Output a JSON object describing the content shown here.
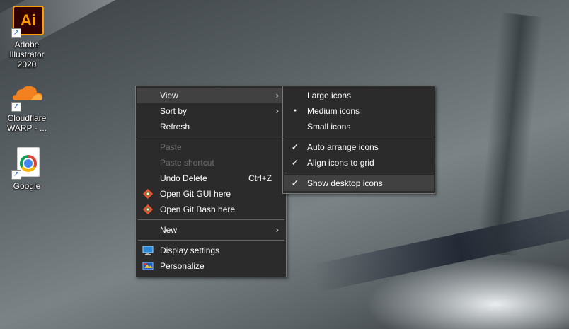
{
  "desktop_icons": [
    {
      "label": "Adobe Illustrator 2020",
      "logo_text": "Ai",
      "icon": "adobe-illustrator-icon"
    },
    {
      "label": "Cloudflare WARP - ...",
      "icon": "cloudflare-icon"
    },
    {
      "label": "Google",
      "icon": "chrome-document-icon"
    }
  ],
  "context_menu": {
    "items": [
      {
        "label": "View",
        "submenu": true
      },
      {
        "label": "Sort by",
        "submenu": true
      },
      {
        "label": "Refresh"
      },
      {
        "label": "Paste",
        "disabled": true
      },
      {
        "label": "Paste shortcut",
        "disabled": true
      },
      {
        "label": "Undo Delete",
        "shortcut": "Ctrl+Z"
      },
      {
        "label": "Open Git GUI here",
        "icon": "git-icon"
      },
      {
        "label": "Open Git Bash here",
        "icon": "git-icon"
      },
      {
        "label": "New",
        "submenu": true
      },
      {
        "label": "Display settings",
        "icon": "display-settings-icon"
      },
      {
        "label": "Personalize",
        "icon": "personalize-icon"
      }
    ]
  },
  "view_submenu": {
    "items": [
      {
        "label": "Large icons"
      },
      {
        "label": "Medium icons",
        "selected": true
      },
      {
        "label": "Small icons"
      },
      {
        "label": "Auto arrange icons",
        "checked": true
      },
      {
        "label": "Align icons to grid",
        "checked": true
      },
      {
        "label": "Show desktop icons",
        "checked": true
      }
    ]
  },
  "glyphs": {
    "arrow": "›",
    "bullet": "●",
    "check": "✓"
  },
  "colors": {
    "menu_bg": "#2b2b2b",
    "menu_hover": "#414141",
    "menu_border": "#7a7a7a",
    "disabled_text": "#6d6d6d"
  }
}
